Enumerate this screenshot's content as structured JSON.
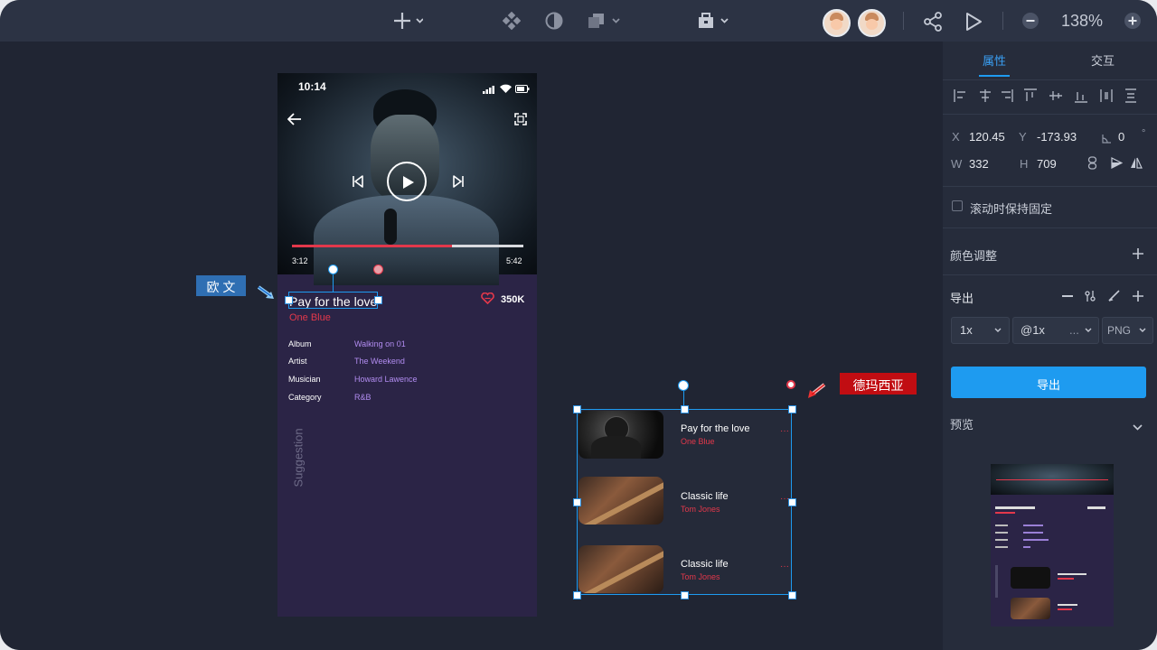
{
  "toolbar": {
    "zoom": "138%",
    "icons": [
      "add-icon",
      "component-icon",
      "contrast-icon",
      "layers-icon",
      "toolbox-icon",
      "share-icon",
      "play-icon",
      "zoom-out-icon",
      "zoom-in-icon"
    ]
  },
  "panel": {
    "tabs": [
      {
        "label": "属性",
        "active": true
      },
      {
        "label": "交互",
        "active": false
      }
    ],
    "x_label": "X",
    "x_value": "120.45",
    "y_label": "Y",
    "y_value": "-173.93",
    "rot_value": "0",
    "deg_unit": "°",
    "w_label": "W",
    "w_value": "332",
    "h_label": "H",
    "h_value": "709",
    "fixed_scroll_label": "滚动时保持固定",
    "color_adjust_label": "颜色调整",
    "export_label": "导出",
    "scale_value": "1x",
    "suffix_value": "@1x",
    "suffix_more": "...",
    "format_value": "PNG",
    "export_button": "导出",
    "preview_label": "预览"
  },
  "phone": {
    "status_time": "10:14",
    "elapsed": "3:12",
    "duration": "5:42",
    "progress": 0.69,
    "song_title": "Pay for the love",
    "artist": "One Blue",
    "likes": "350K",
    "details": [
      {
        "key": "Album",
        "value": "Walking on 01"
      },
      {
        "key": "Artist",
        "value": "The Weekend"
      },
      {
        "key": "Musician",
        "value": "Howard Lawence"
      },
      {
        "key": "Category",
        "value": "R&B"
      }
    ],
    "suggestion_label": "Suggestion"
  },
  "suggestions": [
    {
      "title": "Pay for the love",
      "artist": "One Blue",
      "more": "···"
    },
    {
      "title": "Classic life",
      "artist": "Tom Jones",
      "more": "···"
    },
    {
      "title": "Classic life",
      "artist": "Tom Jones",
      "more": "···"
    }
  ],
  "annotations": {
    "left_label": "欧 文",
    "right_label": "德玛西亚"
  },
  "colors": {
    "accent_blue": "#1e9bf0",
    "accent_red": "#e3384b",
    "phone_bg": "#2b2446",
    "label_blue": "#2f6fb3",
    "label_red": "#c10d12"
  }
}
